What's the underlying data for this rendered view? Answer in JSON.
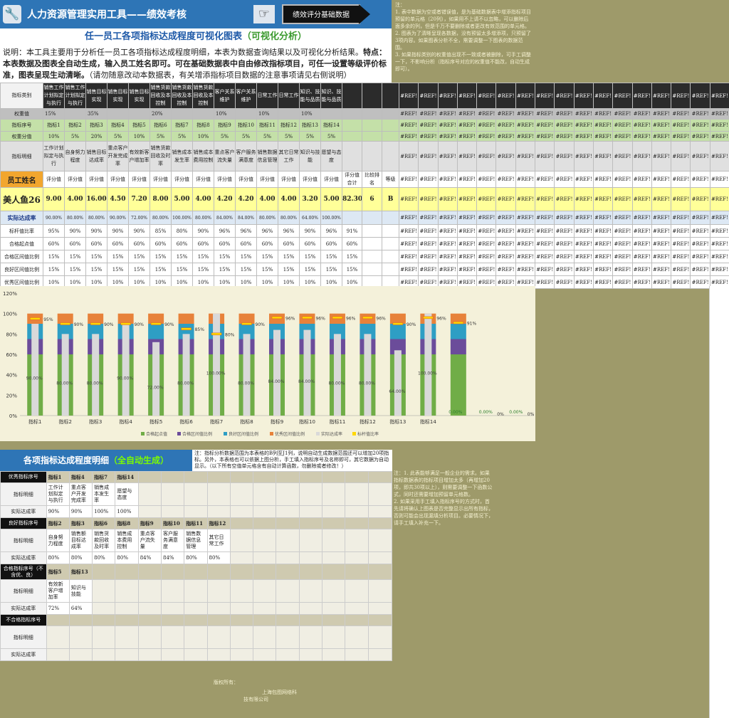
{
  "header": {
    "wrench_icon": "wrench-icon",
    "app_title": "人力资源管理实用工具——绩效考核",
    "hand_icon": "pointing-hand-icon",
    "nav_button": "绩效评分基础数据"
  },
  "subheader": {
    "title": "任一员工各项指标达成程度可视化图表",
    "tag": "（可视化分析）"
  },
  "description": {
    "part1": "说明：本工具主要用于分析任一员工各项指标达成程度明细，本表为数据查询结果以及可视化分析结果。",
    "bold": "特点：本表数据及图表全自动生成，输入员工姓名即可。可在基础数据表中自由修改指标项目，可任一设置等级评价标准，图表呈现生动清晰。",
    "part2": "（请勿随意改动本数据表，有关增添指标项目数据的注意事项请见右侧说明）"
  },
  "right_note_top": "注：\n1. 表中数据为空或者错误值，是为基础数据表中增添指标项目预留的单元格（20列），如果用不上请不以忽略，可以删除后面多余的列，但是千万不要删除或者更改有效范围的单元格。\n2. 图表为了清晰呈现各数据，没有预留太多增添项，只预留了3项内容。如果图表分析不全，需要调整一下图表的数据范围。\n3. 如果指标类别的权重值出现不一致或者被删除，可手工调整一下，不影响分析（指标序号对应的权重值不能改，自动生成即可）。",
  "table": {
    "row_labels": {
      "category": "指标类别",
      "weight": "权重值",
      "index": "指标序号",
      "weight_pts": "权重分值",
      "detail": "指标明细",
      "emp_name_label": "员工姓名",
      "achieve": "实际达成率",
      "bench": "标杆值比率",
      "pass_start": "合格起点值",
      "pass_range": "合格区间值比例",
      "good_range": "良好区间值比例",
      "excel_range": "优秀区间值比例"
    },
    "categories": [
      "销售工作计划拟定与执行",
      "销售工作计划拟定与执行",
      "销售目标实现",
      "销售目标实现",
      "销售目标实现",
      "销售货款回收及本控制",
      "销售货款回收及本控制",
      "销售货款回收及本控制",
      "客户关系维护",
      "客户关系维护",
      "日常工作",
      "日常工作",
      "知识、技能与品质",
      "知识、技能与品质"
    ],
    "weights": [
      "15%",
      "",
      "35%",
      "",
      "",
      "20%",
      "",
      "",
      "10%",
      "",
      "10%",
      "",
      "10%",
      ""
    ],
    "indices": [
      "指标1",
      "指标2",
      "指标3",
      "指标4",
      "指标5",
      "指标6",
      "指标7",
      "指标8",
      "指标9",
      "指标10",
      "指标11",
      "指标12",
      "指标13",
      "指标14"
    ],
    "weight_pts": [
      "10%",
      "5%",
      "20%",
      "5%",
      "10%",
      "5%",
      "5%",
      "10%",
      "5%",
      "5%",
      "5%",
      "5%",
      "5%",
      "5%"
    ],
    "details": [
      "工作计划拟定与执行",
      "自身努力程度",
      "销售目标达成率",
      "重点客户开发完成率",
      "有效新客户增加率",
      "销售货款回收及时率",
      "销售成本发生率",
      "销售成本费用控制",
      "重点客户流失量",
      "客户服务满意度",
      "销售数据信息管理",
      "其它日常工作",
      "知识与技能",
      "愿望与态度"
    ],
    "score_header": "评分值",
    "total_header": "评分值合计",
    "rank_header": "比较排名",
    "grade_header": "等级",
    "employee_name": "美人鱼26",
    "scores": [
      "9.00",
      "4.00",
      "16.00",
      "4.50",
      "7.20",
      "8.00",
      "5.00",
      "4.00",
      "4.20",
      "4.20",
      "4.00",
      "4.00",
      "3.20",
      "5.00"
    ],
    "total": "82.30",
    "rank": "6",
    "grade": "B",
    "achieve": [
      "90.00%",
      "80.00%",
      "80.00%",
      "90.00%",
      "72.00%",
      "80.00%",
      "100.00%",
      "80.00%",
      "84.00%",
      "84.00%",
      "80.00%",
      "80.00%",
      "64.00%",
      "100.00%"
    ],
    "bench": [
      "95%",
      "90%",
      "90%",
      "90%",
      "90%",
      "85%",
      "80%",
      "90%",
      "96%",
      "96%",
      "96%",
      "96%",
      "90%",
      "96%",
      "91%"
    ],
    "pass_start": [
      "60%",
      "60%",
      "60%",
      "60%",
      "60%",
      "60%",
      "60%",
      "60%",
      "60%",
      "60%",
      "60%",
      "60%",
      "60%",
      "60%",
      "60%"
    ],
    "pass_range": [
      "15%",
      "15%",
      "15%",
      "15%",
      "15%",
      "15%",
      "15%",
      "15%",
      "15%",
      "15%",
      "15%",
      "15%",
      "15%",
      "15%",
      "15%"
    ],
    "good_range": [
      "15%",
      "15%",
      "15%",
      "15%",
      "15%",
      "15%",
      "15%",
      "15%",
      "15%",
      "15%",
      "15%",
      "15%",
      "15%",
      "15%",
      "15%"
    ],
    "excel_range": [
      "10%",
      "10%",
      "10%",
      "10%",
      "10%",
      "10%",
      "10%",
      "10%",
      "10%",
      "10%",
      "10%",
      "10%",
      "10%",
      "10%",
      "10%"
    ],
    "ref": "#REF!"
  },
  "chart_data": {
    "type": "bar",
    "categories": [
      "指标1",
      "指标2",
      "指标3",
      "指标4",
      "指标5",
      "指标6",
      "指标7",
      "指标8",
      "指标9",
      "指标10",
      "指标11",
      "指标12",
      "指标13",
      "指标14",
      "",
      "",
      ""
    ],
    "ylim": [
      0,
      1.2
    ],
    "yticks": [
      "0%",
      "20%",
      "40%",
      "60%",
      "80%",
      "100%",
      "120%"
    ],
    "series": [
      {
        "name": "合格起点值",
        "color": "#70ad47",
        "values": [
          0.6,
          0.6,
          0.6,
          0.6,
          0.6,
          0.6,
          0.6,
          0.6,
          0.6,
          0.6,
          0.6,
          0.6,
          0.6,
          0.6,
          0.6,
          0,
          0
        ]
      },
      {
        "name": "合格区间值比例",
        "color": "#6b4c9a",
        "values": [
          0.15,
          0.15,
          0.15,
          0.15,
          0.15,
          0.15,
          0.15,
          0.15,
          0.15,
          0.15,
          0.15,
          0.15,
          0.15,
          0.15,
          0.15,
          0,
          0
        ]
      },
      {
        "name": "良好区间值比例",
        "color": "#2e9ec4",
        "values": [
          0.15,
          0.15,
          0.15,
          0.15,
          0.15,
          0.15,
          0.15,
          0.15,
          0.15,
          0.15,
          0.15,
          0.15,
          0.15,
          0.15,
          0.15,
          0,
          0
        ]
      },
      {
        "name": "优秀区间值比例",
        "color": "#e7823a",
        "values": [
          0.1,
          0.1,
          0.1,
          0.1,
          0.1,
          0.1,
          0.1,
          0.1,
          0.1,
          0.1,
          0.1,
          0.1,
          0.1,
          0.1,
          0.1,
          0,
          0
        ]
      },
      {
        "name": "实际达成率",
        "color": "#d9d9d9",
        "values": [
          0.9,
          0.8,
          0.8,
          0.9,
          0.72,
          0.8,
          1.0,
          0.8,
          0.84,
          0.84,
          0.8,
          0.8,
          0.64,
          1.0,
          0,
          0,
          0
        ]
      },
      {
        "name": "标杆值比率",
        "color": "#ffd700",
        "values": [
          0.95,
          0.9,
          0.9,
          0.9,
          0.9,
          0.85,
          0.8,
          0.9,
          0.96,
          0.96,
          0.96,
          0.96,
          0.9,
          0.96,
          0.91,
          0,
          0
        ]
      }
    ],
    "achieve_labels": [
      "90.00%",
      "80.00%",
      "80.00%",
      "90.00%",
      "72.00%",
      "80.00%",
      "100.00%",
      "80.00%",
      "84.00%",
      "84.00%",
      "80.00%",
      "80.00%",
      "64.00%",
      "100.00%",
      "0.00%",
      "0.00%",
      "0.00%"
    ],
    "bench_labels": [
      "95%",
      "90%",
      "90%",
      "90%",
      "90%",
      "85%",
      "80%",
      "90%",
      "96%",
      "96%",
      "96%",
      "96%",
      "90%",
      "96%",
      "91%",
      "0%",
      "0%"
    ],
    "legend_position": "bottom"
  },
  "detail": {
    "title": "各项指标达成程度明细",
    "tag": "（全自动生成）",
    "note": "注：指标分析数据范围为本表格的B列至J1列，说明自动生成数据范围还可以增加20项指标。另外，本表格也可以依据上图分析，手工填入指标序号及名称即可，其它数据为自动显示。（以下所有空值单元格含有自动计算函数，勿删除或者修改！）",
    "labels": {
      "detail": "指标明细",
      "achieve": "实际达成率"
    },
    "groups": [
      {
        "head": "优秀指标序号",
        "indices": [
          "指标1",
          "指标4",
          "指标7",
          "指标14"
        ],
        "details": [
          "工作计划拟定与执行",
          "重点客户开发完成率",
          "销售成本发生率",
          "愿望与态度"
        ],
        "achieve": [
          "90%",
          "90%",
          "100%",
          "100%"
        ]
      },
      {
        "head": "良好指标序号",
        "indices": [
          "指标2",
          "指标3",
          "指标6",
          "指标8",
          "指标9",
          "指标10",
          "指标11",
          "指标12"
        ],
        "details": [
          "自身努力程度",
          "销售额目标达成率",
          "销售货款回收及时率",
          "销售成本费用控制",
          "重点客户流失量",
          "客户服务满意度",
          "销售数据信息管理",
          "其它日常工作"
        ],
        "achieve": [
          "80%",
          "80%",
          "80%",
          "80%",
          "84%",
          "84%",
          "80%",
          "80%"
        ]
      },
      {
        "head": "合格指标序号（不含优、良）",
        "indices": [
          "指标5",
          "指标13"
        ],
        "details": [
          "有效新客户增加率",
          "知识与技能"
        ],
        "achieve": [
          "72%",
          "64%"
        ]
      },
      {
        "head": "不合格指标序号",
        "indices": [],
        "details": [],
        "achieve": []
      }
    ]
  },
  "right_note_mid": "注：1. 此表能够满足一般企业的需求。如果指标数据表的指标项目增加太多（再增加20项，即共30项以上），则需要调整一下函数公式，同时还需要增加预留单元格数。\n2. 如果采用手工填入指标序号的方式时，首先请将确认上图表是否完整显示出所有指标，否则可能会出现漏填分析项目。必要情况下，请手工填入补充一下。",
  "footer": {
    "copyright": "版权所有：",
    "company": "上海包图网络科",
    "company2": "技有限公司"
  }
}
